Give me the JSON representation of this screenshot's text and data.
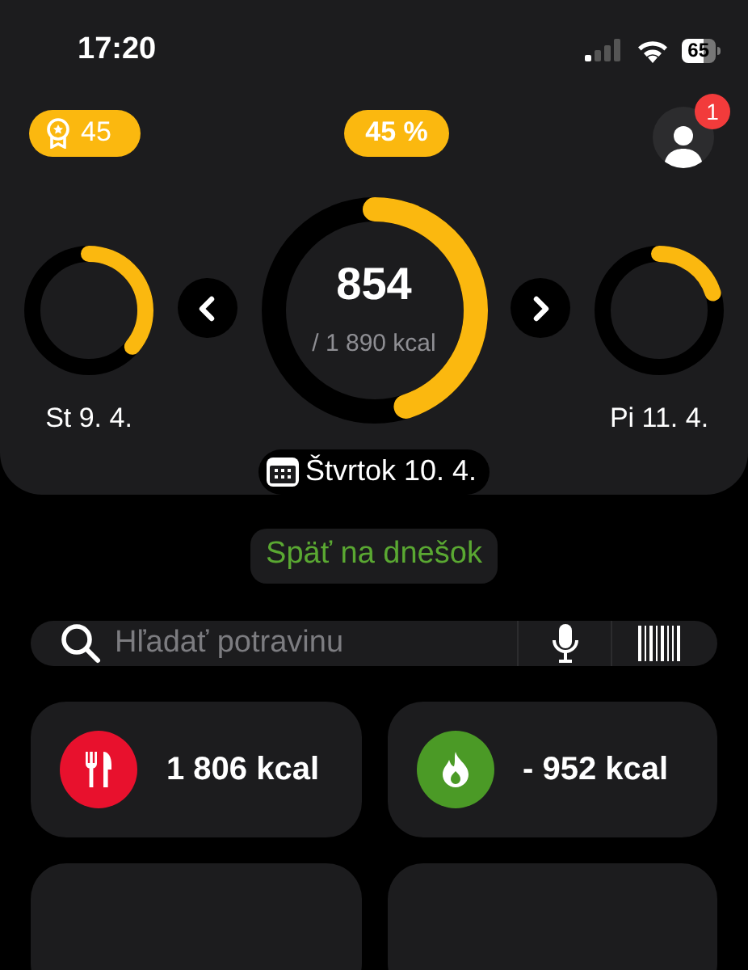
{
  "status_bar": {
    "time": "17:20",
    "battery": "65"
  },
  "header": {
    "streak": "45",
    "percent": "45 %",
    "notifications": "1"
  },
  "days": [
    {
      "kind": "side",
      "label": "St 9. 4.",
      "level": 0.36
    },
    {
      "kind": "main",
      "value": "854",
      "goal": "/ 1 890 kcal",
      "level": 0.45
    },
    {
      "kind": "side",
      "label": "Pi 11. 4.",
      "level": 0.2
    }
  ],
  "date_pill": "Štvrtok 10. 4.",
  "back_button": "Späť na dnešok",
  "search": {
    "placeholder": "Hľadať potravinu"
  },
  "cards": [
    {
      "kind": "food",
      "value": "1 806 kcal",
      "color": "#e8112d"
    },
    {
      "kind": "burn",
      "value": "- 952 kcal",
      "color": "#4b9a26"
    }
  ]
}
